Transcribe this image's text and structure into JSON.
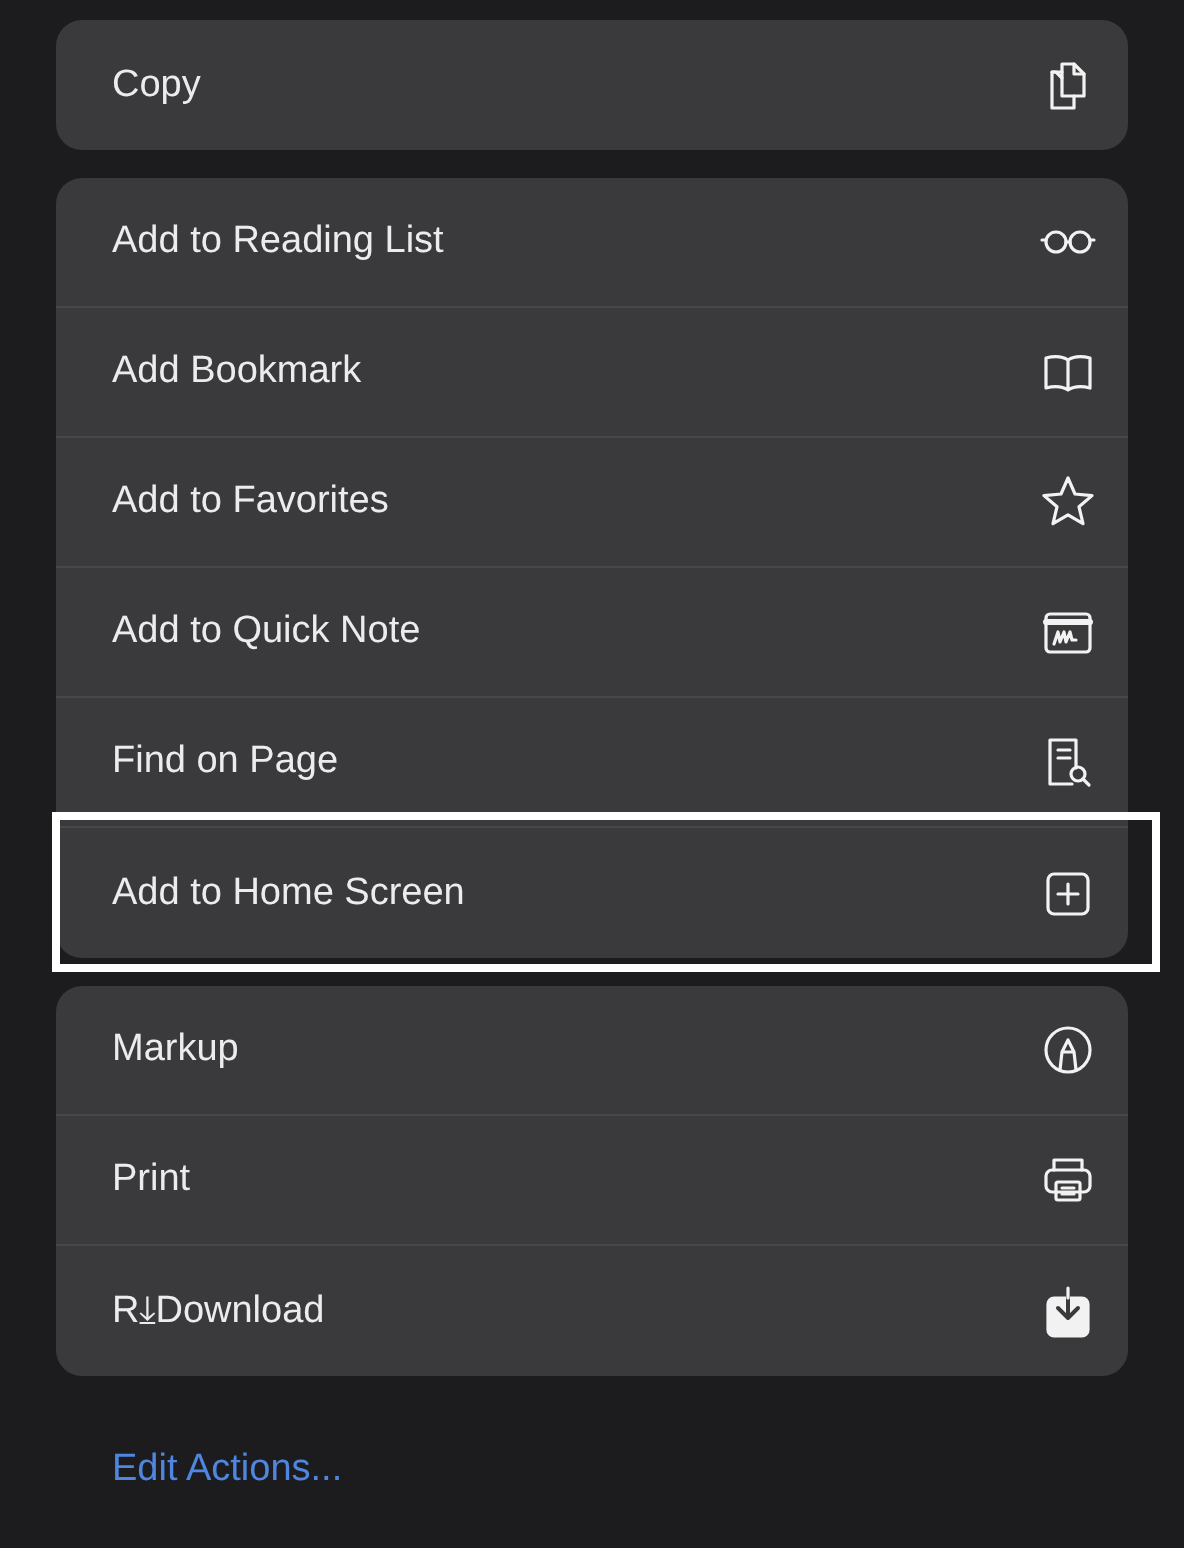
{
  "groups": [
    {
      "items": [
        {
          "label": "Copy",
          "kind": "copy",
          "highlighted": false
        }
      ]
    },
    {
      "items": [
        {
          "label": "Add to Reading List",
          "kind": "glasses",
          "highlighted": false
        },
        {
          "label": "Add Bookmark",
          "kind": "book",
          "highlighted": false
        },
        {
          "label": "Add to Favorites",
          "kind": "star",
          "highlighted": false
        },
        {
          "label": "Add to Quick Note",
          "kind": "note",
          "highlighted": false
        },
        {
          "label": "Find on Page",
          "kind": "find",
          "highlighted": false
        },
        {
          "label": "Add to Home Screen",
          "kind": "plus",
          "highlighted": true
        }
      ]
    },
    {
      "items": [
        {
          "label": "Markup",
          "kind": "markup",
          "highlighted": false
        },
        {
          "label": "Print",
          "kind": "print",
          "highlighted": false
        },
        {
          "label": "R⤓Download",
          "kind": "download",
          "highlighted": false
        }
      ]
    }
  ],
  "edit_actions": "Edit Actions..."
}
